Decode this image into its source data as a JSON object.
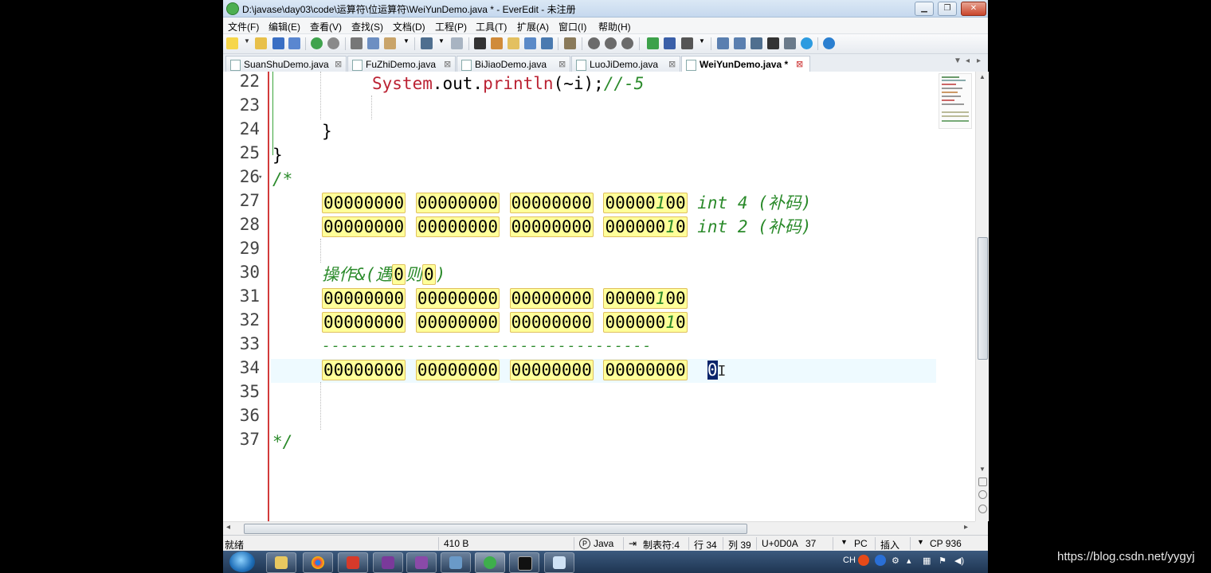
{
  "window": {
    "title": "D:\\javase\\day03\\code\\运算符\\位运算符\\WeiYunDemo.java * - EverEdit - 未注册",
    "minimize_icon": "minimize-icon",
    "maximize_icon": "maximize-icon",
    "close_icon": "close-icon"
  },
  "menu": [
    "文件(F)",
    "编辑(E)",
    "查看(V)",
    "查找(S)",
    "文档(D)",
    "工程(P)",
    "工具(T)",
    "扩展(A)",
    "窗口(I)",
    "帮助(H)"
  ],
  "tabs": [
    {
      "label": "SuanShuDemo.java",
      "active": false
    },
    {
      "label": "FuZhiDemo.java",
      "active": false
    },
    {
      "label": "BiJiaoDemo.java",
      "active": false
    },
    {
      "label": "LuoJiDemo.java",
      "active": false
    },
    {
      "label": "WeiYunDemo.java *",
      "active": true
    }
  ],
  "tab_close_glyph": "⊠",
  "line_numbers": [
    "22",
    "23",
    "24",
    "25",
    "26",
    "27",
    "28",
    "29",
    "30",
    "31",
    "32",
    "33",
    "34",
    "35",
    "36",
    "37"
  ],
  "code": {
    "l22_sys": "System",
    "l22_rest": ".out.",
    "l22_println": "println",
    "l22_args": "(~i);",
    "l22_comment": "//-5",
    "l24": "}",
    "l25": "}",
    "l26": "/*",
    "l27": {
      "b1": "00000000",
      "b2": "00000000",
      "b3": "00000000",
      "b4a": "00000",
      "b4b": "1",
      "b4c": "00",
      "note": "int 4 (补码)"
    },
    "l28": {
      "b1": "00000000",
      "b2": "00000000",
      "b3": "00000000",
      "b4a": "000000",
      "b4b": "1",
      "b4c": "0",
      "note": "int 2 (补码)"
    },
    "l30": {
      "a": "操作&(遇",
      "z1": "0",
      "b": "则",
      "z2": "0",
      "c": ")"
    },
    "l31": {
      "b1": "00000000",
      "b2": "00000000",
      "b3": "00000000",
      "b4a": "00000",
      "b4b": "1",
      "b4c": "00"
    },
    "l32": {
      "b1": "00000000",
      "b2": "00000000",
      "b3": "00000000",
      "b4a": "000000",
      "b4b": "1",
      "b4c": "0"
    },
    "l33": "-----------------------------------",
    "l34": {
      "b1": "00000000",
      "b2": "00000000",
      "b3": "00000000",
      "b4": "00000000",
      "result": "0"
    },
    "l37": "*/"
  },
  "status": {
    "ready": "就绪",
    "size": "410 B",
    "language": "Java",
    "tab": "制表符:4",
    "row": "行 34",
    "col": "列 39",
    "char": "U+0D0A",
    "charnum": "37",
    "eol": "PC",
    "mode": "插入",
    "encoding": "CP 936"
  },
  "tray": {
    "lang": "CH"
  },
  "watermark": "https://blog.csdn.net/yygyj",
  "colors": {
    "accent": "#0a246a",
    "highlight": "#ffff99",
    "comment": "#2a8a2a",
    "gutter_line": "#d23b3b"
  }
}
